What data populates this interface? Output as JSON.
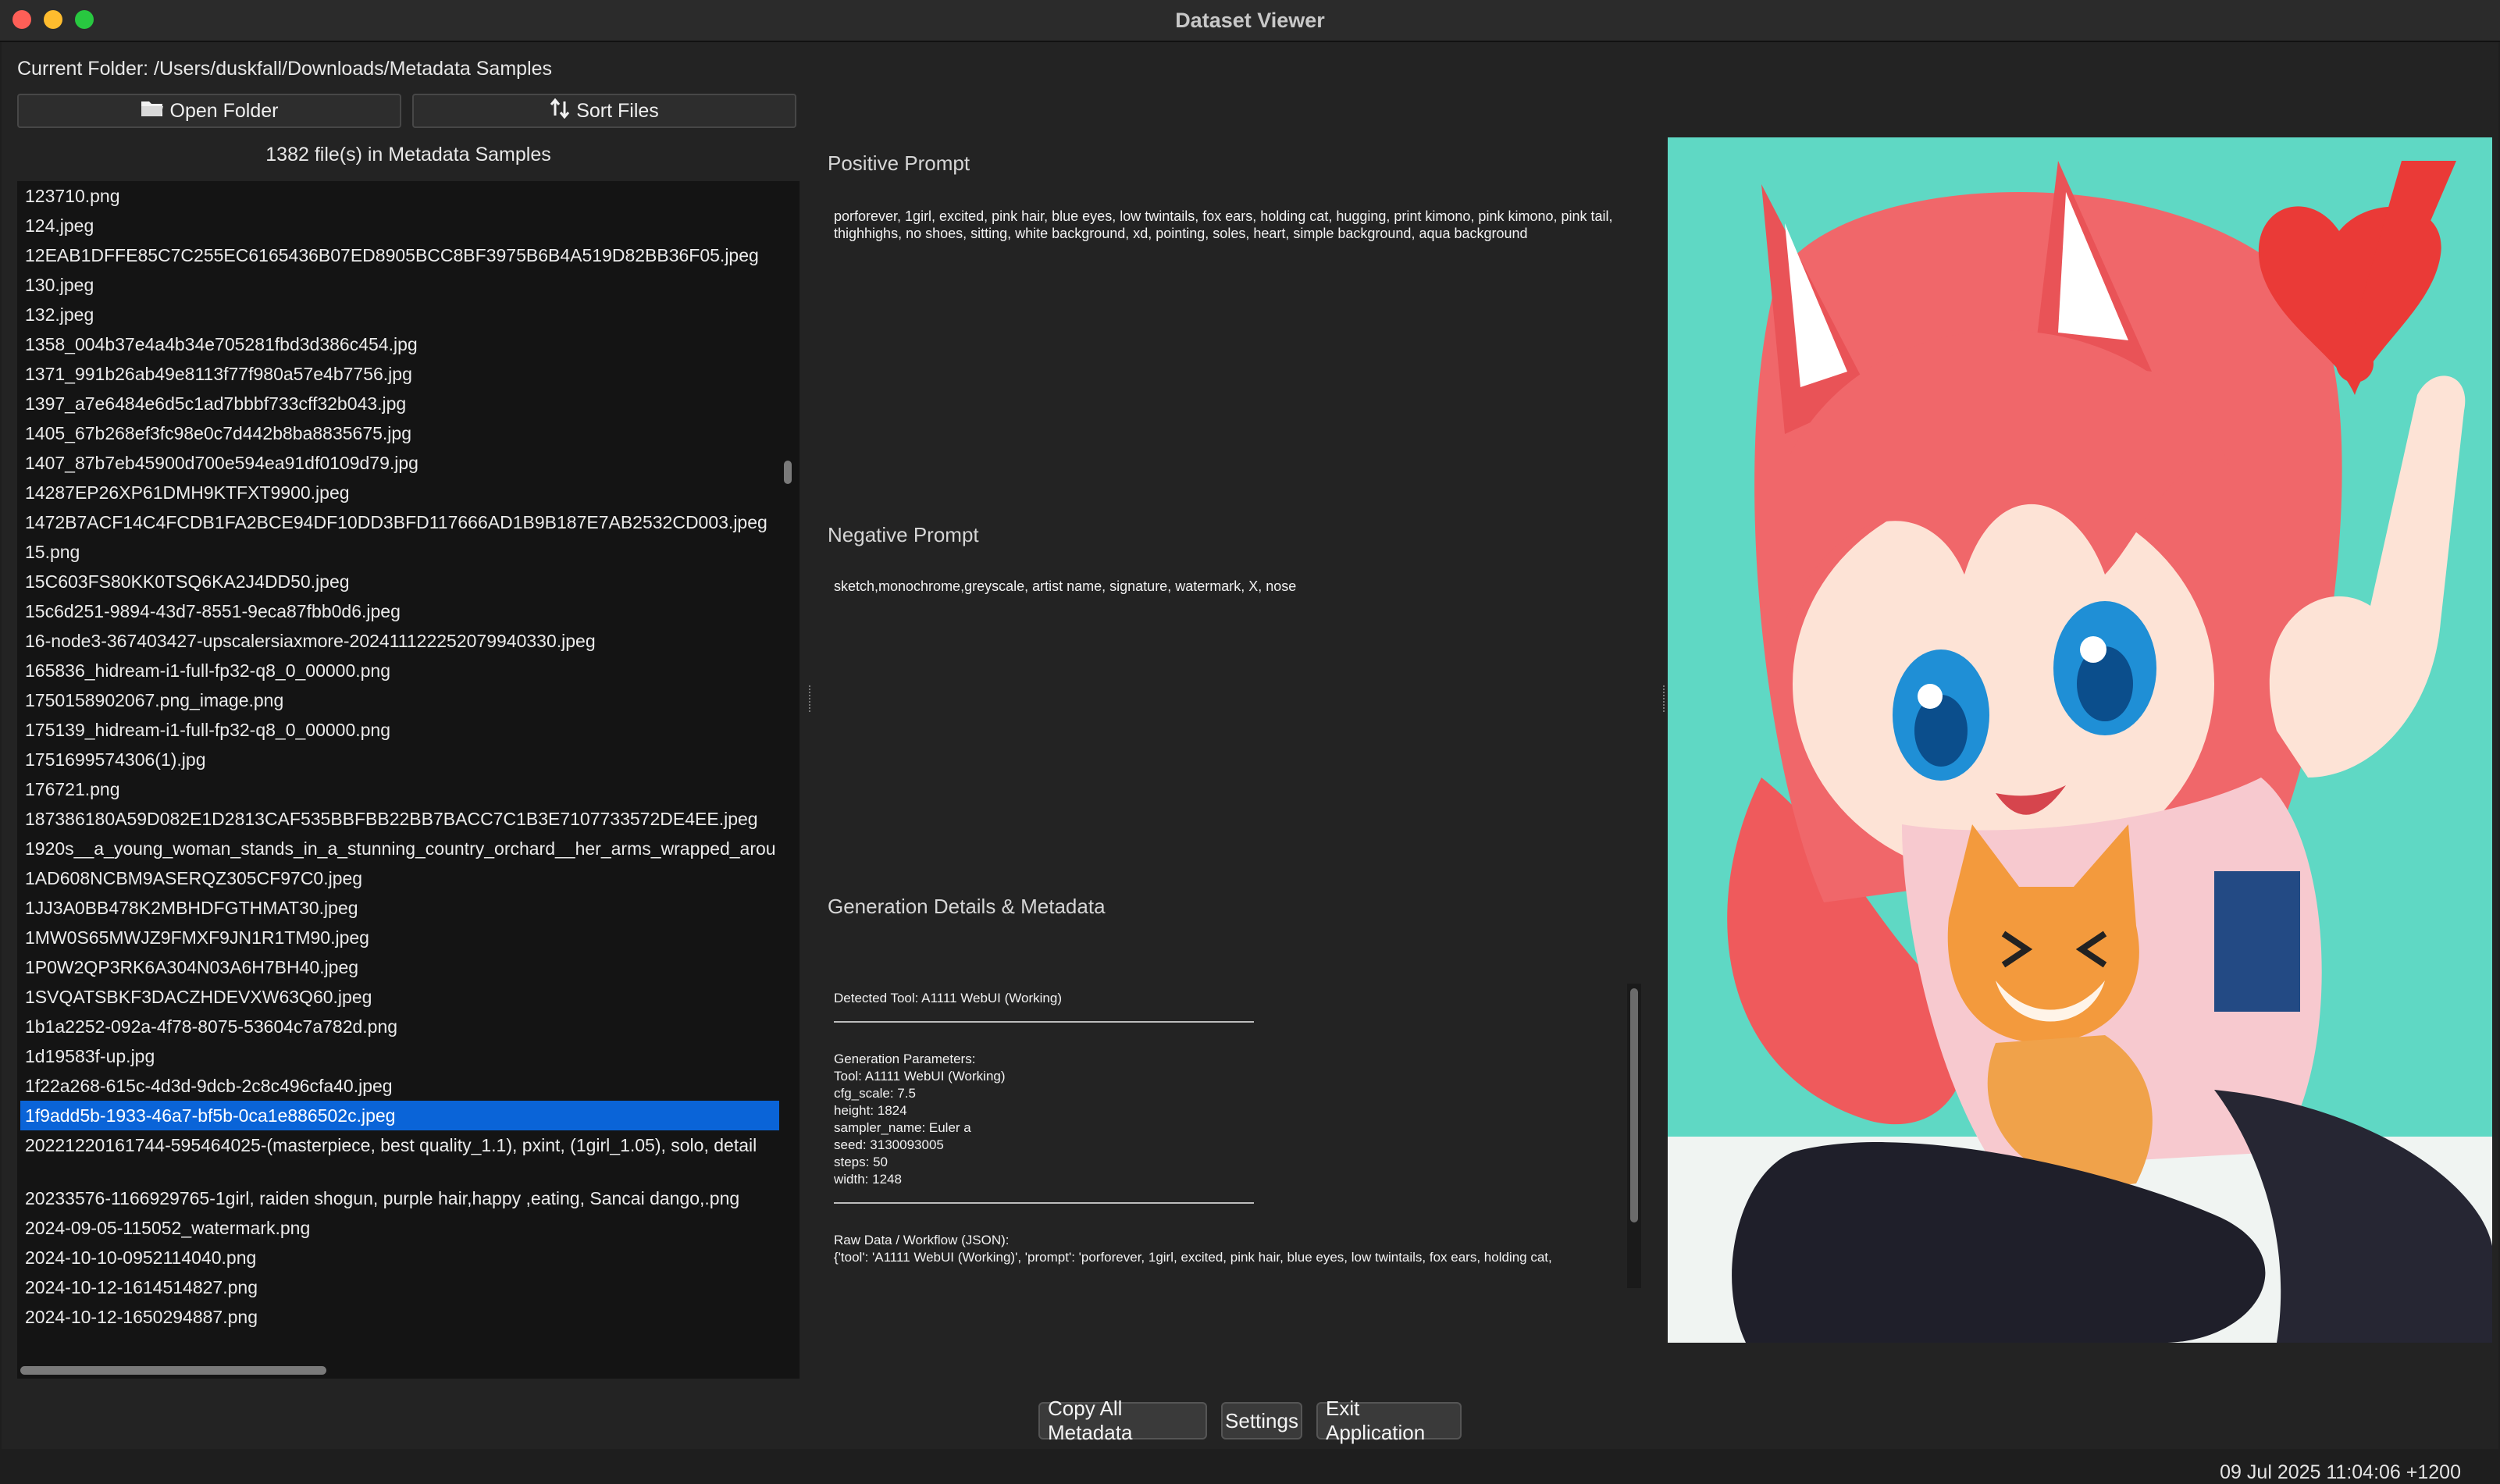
{
  "window": {
    "title": "Dataset Viewer"
  },
  "left": {
    "current_folder": "Current Folder: /Users/duskfall/Downloads/Metadata Samples",
    "open_folder_label": "Open Folder",
    "sort_files_label": "Sort Files",
    "file_count": "1382 file(s) in Metadata Samples",
    "files": [
      "123710.png",
      "124.jpeg",
      "12EAB1DFFE85C7C255EC6165436B07ED8905BCC8BF3975B6B4A519D82BB36F05.jpeg",
      "130.jpeg",
      "132.jpeg",
      "1358_004b37e4a4b34e705281fbd3d386c454.jpg",
      "1371_991b26ab49e8113f77f980a57e4b7756.jpg",
      "1397_a7e6484e6d5c1ad7bbbf733cff32b043.jpg",
      "1405_67b268ef3fc98e0c7d442b8ba8835675.jpg",
      "1407_87b7eb45900d700e594ea91df0109d79.jpg",
      "14287EP26XP61DMH9KTFXT9900.jpeg",
      "1472B7ACF14C4FCDB1FA2BCE94DF10DD3BFD117666AD1B9B187E7AB2532CD003.jpeg",
      "15.png",
      "15C603FS80KK0TSQ6KA2J4DD50.jpeg",
      "15c6d251-9894-43d7-8551-9eca87fbb0d6.jpeg",
      "16-node3-367403427-upscalersiaxmore-20241112225207994033​0.jpeg",
      "165836_hidream-i1-full-fp32-q8_0_00000.png",
      "1750158902067.png_image.png",
      "175139_hidream-i1-full-fp32-q8_0_00000.png",
      "1751699574306(1).jpg",
      "176721.png",
      "187386180A59D082E1D2813CAF535BBFBB22BB7BACC7C1B3E7107733572DE4EE.jpeg",
      "1920s__a_young_woman_stands_in_a_stunning_country_orchard__her_arms_wrapped_arou",
      "1AD608NCBM9ASERQZ305CF97C0.jpeg",
      "1JJ3A0BB478K2MBHDFGTHMAT30.jpeg",
      "1MW0S65MWJZ9FMXF9JN1R1TM90.jpeg",
      "1P0W2QP3RK6A304N03A6H7BH40.jpeg",
      "1SVQATSBKF3DACZHDEVXW63Q60.jpeg",
      "1b1a2252-092a-4f78-8075-53604c7a782d.png",
      "1d19583f-up.jpg",
      "1f22a268-615c-4d3d-9dcb-2c8c496cfa40.jpeg",
      "1f9add5b-1933-46a7-bf5b-0ca1e886502c.jpeg",
      "20221220161744-595464025-(masterpiece, best quality_1.1), pxint, (1girl_1.05), solo, detail",
      "",
      "20233576-1166929765-1girl, raiden shogun, purple hair,happy ,eating, Sancai dango,.png",
      "2024-09-05-115052_watermark.png",
      "2024-10-10-0952114040.png",
      "2024-10-12-1614514827.png",
      "2024-10-12-1650294887.png"
    ],
    "selected_file": "1f9add5b-1933-46a7-bf5b-0ca1e886502c.jpeg"
  },
  "middle": {
    "positive_title": "Positive Prompt",
    "positive_text": "porforever, 1girl, excited, pink hair, blue eyes, low twintails, fox ears, holding cat, hugging, print kimono, pink kimono, pink tail, thighhighs, no shoes, sitting, white background, xd, pointing, soles, heart, simple background, aqua background",
    "negative_title": "Negative Prompt",
    "negative_text": "sketch,monochrome,greyscale, artist name, signature, watermark, X, nose",
    "details_title": "Generation Details & Metadata",
    "detected_tool": "Detected Tool: A1111 WebUI (Working)",
    "gen_params_header": "Generation Parameters:",
    "gen_params": [
      "Tool: A1111 WebUI (Working)",
      "cfg_scale: 7.5",
      "height: 1824",
      "sampler_name: Euler a",
      "seed: 3130093005",
      "steps: 50",
      "width: 1248"
    ],
    "raw_header": "Raw Data / Workflow (JSON):",
    "raw_text": "{'tool': 'A1111 WebUI (Working)', 'prompt': 'porforever, 1girl, excited, pink hair, blue eyes, low twintails, fox ears, holding cat,"
  },
  "bottom": {
    "copy_label": "Copy All Metadata",
    "settings_label": "Settings",
    "exit_label": "Exit Application",
    "timestamp": "09 Jul 2025 11:04:06 +1200"
  },
  "colors": {
    "selection": "#0a64d8",
    "background": "#232323",
    "image_bg": "#5fd8c4"
  }
}
